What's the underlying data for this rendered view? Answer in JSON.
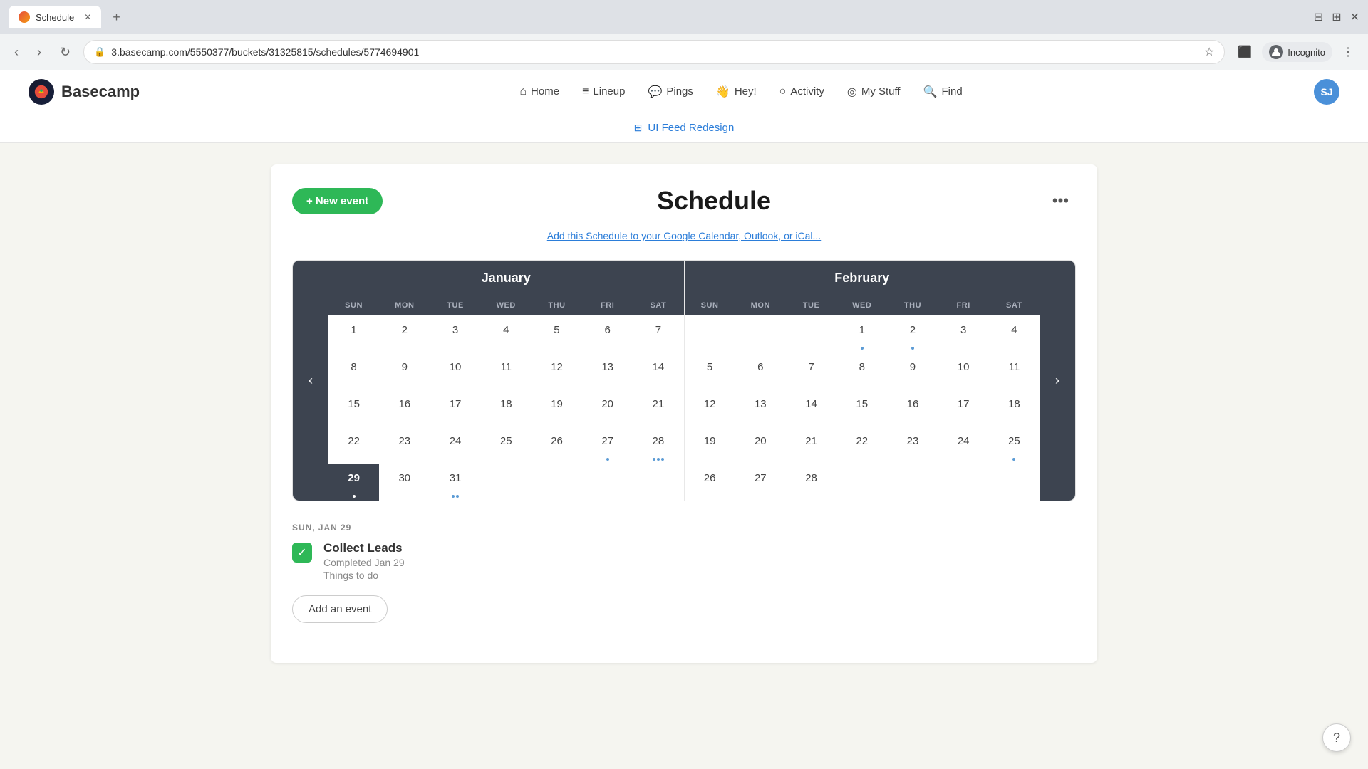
{
  "browser": {
    "tab_title": "Schedule",
    "url": "3.basecamp.com/5550377/buckets/31325815/schedules/5774694901",
    "incognito_label": "Incognito"
  },
  "nav": {
    "logo_text": "Basecamp",
    "home_label": "Home",
    "lineup_label": "Lineup",
    "pings_label": "Pings",
    "hey_label": "Hey!",
    "activity_label": "Activity",
    "my_stuff_label": "My Stuff",
    "find_label": "Find",
    "user_initials": "SJ"
  },
  "subheader": {
    "project_link": "UI Feed Redesign"
  },
  "page": {
    "new_event_label": "+ New event",
    "title": "Schedule",
    "calendar_link": "Add this Schedule to your Google Calendar, Outlook, or iCal...",
    "more_options_label": "•••"
  },
  "calendar": {
    "prev_label": "‹",
    "next_label": "›",
    "month1": "January",
    "month2": "February",
    "day_names": [
      "SUN",
      "MON",
      "TUE",
      "WED",
      "THU",
      "FRI",
      "SAT"
    ],
    "january_days": [
      {
        "day": 1,
        "dots": []
      },
      {
        "day": 2,
        "dots": []
      },
      {
        "day": 3,
        "dots": []
      },
      {
        "day": 4,
        "dots": []
      },
      {
        "day": 5,
        "dots": []
      },
      {
        "day": 6,
        "dots": []
      },
      {
        "day": 7,
        "dots": []
      },
      {
        "day": 8,
        "dots": []
      },
      {
        "day": 9,
        "dots": []
      },
      {
        "day": 10,
        "dots": []
      },
      {
        "day": 11,
        "dots": []
      },
      {
        "day": 12,
        "dots": []
      },
      {
        "day": 13,
        "dots": []
      },
      {
        "day": 14,
        "dots": []
      },
      {
        "day": 15,
        "dots": []
      },
      {
        "day": 16,
        "dots": []
      },
      {
        "day": 17,
        "dots": []
      },
      {
        "day": 18,
        "dots": []
      },
      {
        "day": 19,
        "dots": []
      },
      {
        "day": 20,
        "dots": []
      },
      {
        "day": 21,
        "dots": []
      },
      {
        "day": 22,
        "dots": []
      },
      {
        "day": 23,
        "dots": []
      },
      {
        "day": 24,
        "dots": []
      },
      {
        "day": 25,
        "dots": []
      },
      {
        "day": 26,
        "dots": []
      },
      {
        "day": 27,
        "dots": [
          "blue"
        ]
      },
      {
        "day": 28,
        "dots": [
          "blue",
          "blue",
          "blue"
        ]
      },
      {
        "day": 29,
        "dots": [
          "blue"
        ],
        "selected": true
      },
      {
        "day": 30,
        "dots": []
      },
      {
        "day": 31,
        "dots": [
          "blue",
          "blue"
        ]
      }
    ],
    "february_days": [
      {
        "day": 1,
        "dots": [
          "blue"
        ]
      },
      {
        "day": 2,
        "dots": [
          "blue"
        ]
      },
      {
        "day": 3,
        "dots": []
      },
      {
        "day": 4,
        "dots": []
      },
      {
        "day": 5,
        "dots": []
      },
      {
        "day": 6,
        "dots": []
      },
      {
        "day": 7,
        "dots": []
      },
      {
        "day": 8,
        "dots": []
      },
      {
        "day": 9,
        "dots": []
      },
      {
        "day": 10,
        "dots": []
      },
      {
        "day": 11,
        "dots": []
      },
      {
        "day": 12,
        "dots": []
      },
      {
        "day": 13,
        "dots": []
      },
      {
        "day": 14,
        "dots": []
      },
      {
        "day": 15,
        "dots": []
      },
      {
        "day": 16,
        "dots": []
      },
      {
        "day": 17,
        "dots": []
      },
      {
        "day": 18,
        "dots": []
      },
      {
        "day": 19,
        "dots": []
      },
      {
        "day": 20,
        "dots": []
      },
      {
        "day": 21,
        "dots": []
      },
      {
        "day": 22,
        "dots": []
      },
      {
        "day": 23,
        "dots": []
      },
      {
        "day": 24,
        "dots": []
      },
      {
        "day": 25,
        "dots": [
          "blue"
        ]
      },
      {
        "day": 26,
        "dots": []
      },
      {
        "day": 27,
        "dots": []
      },
      {
        "day": 28,
        "dots": []
      }
    ]
  },
  "events": {
    "date_label": "SUN, JAN 29",
    "items": [
      {
        "title": "Collect Leads",
        "subtitle1": "Completed Jan 29",
        "subtitle2": "Things to do",
        "checked": true
      }
    ],
    "add_event_label": "Add an event"
  }
}
